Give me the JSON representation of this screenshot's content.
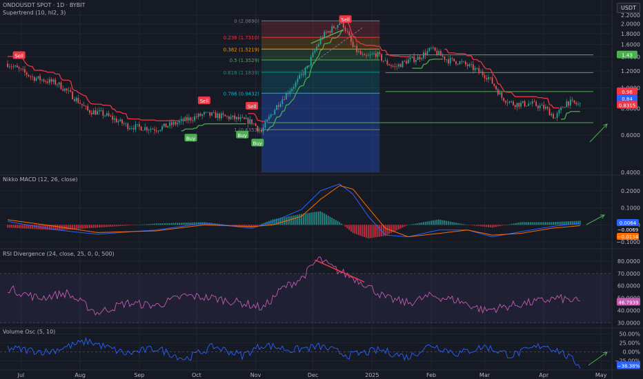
{
  "header": {
    "symbol_title": "ONDOUSDT SPOT · 1D · BYBIT",
    "supertrend_label": "Supertrend (10, hl2, 3)",
    "currency_button": "USDT"
  },
  "colors": {
    "background": "#161a25",
    "grid": "#222631",
    "bull": "#26a69a",
    "bear": "#ef5350",
    "supertrend_up": "#4caf50",
    "supertrend_down": "#f23645",
    "macd_line": "#2962ff",
    "signal_line": "#ff6d00",
    "rsi_line": "#c45bb0",
    "volume_osc_line": "#2962ff",
    "arrow_green": "#4caf50",
    "divergence_red": "#f23645"
  },
  "chart_data": [
    {
      "type": "candlestick",
      "name": "price",
      "y_axis": {
        "scale": "log",
        "ylim": [
          0.4,
          2.2
        ],
        "ticks": [
          "2.2000",
          "2.0000",
          "1.8000",
          "1.6000",
          "1.4000",
          "1.2000",
          "1.0000",
          "0.8000",
          "0.6000",
          "0.4000"
        ]
      },
      "x_ticks": [
        "Jul",
        "Aug",
        "Sep",
        "Oct",
        "Nov",
        "Dec",
        "2025",
        "Feb",
        "Mar",
        "Apr",
        "May"
      ],
      "path_dates": [
        "2024-06-24",
        "2024-07-07",
        "2024-07-20",
        "2024-08-05",
        "2024-08-12",
        "2024-08-26",
        "2024-09-10",
        "2024-09-20",
        "2024-10-05",
        "2024-10-12",
        "2024-10-20",
        "2024-10-30",
        "2024-11-04",
        "2024-11-12",
        "2024-11-22",
        "2024-11-28",
        "2024-12-06",
        "2024-12-11",
        "2024-12-16",
        "2024-12-22",
        "2024-12-28",
        "2025-01-03",
        "2025-01-08",
        "2025-01-13",
        "2025-01-20",
        "2025-01-25",
        "2025-02-01",
        "2025-02-06",
        "2025-02-10",
        "2025-02-15",
        "2025-02-22",
        "2025-03-03",
        "2025-03-10",
        "2025-03-16",
        "2025-03-26",
        "2025-04-02",
        "2025-04-07",
        "2025-04-13",
        "2025-04-20"
      ],
      "path_prices": [
        1.3,
        1.12,
        1.05,
        0.78,
        0.76,
        0.66,
        0.64,
        0.68,
        0.75,
        0.74,
        0.72,
        0.69,
        0.62,
        0.82,
        1.05,
        1.24,
        1.75,
        1.9,
        2.06,
        1.55,
        1.38,
        1.45,
        1.32,
        1.25,
        1.35,
        1.38,
        1.52,
        1.42,
        1.35,
        1.33,
        1.25,
        1.12,
        0.9,
        0.84,
        0.84,
        0.8,
        0.72,
        0.86,
        0.83
      ],
      "fibonacci": [
        {
          "label": "0 (2.0690)",
          "price": 2.069,
          "color": "#787b86"
        },
        {
          "label": "0.236 (1.7310)",
          "price": 1.731,
          "color": "#f23645"
        },
        {
          "label": "0.382 (1.5219)",
          "price": 1.5219,
          "color": "#ff9800"
        },
        {
          "label": "0.5 (1.3529)",
          "price": 1.3529,
          "color": "#4caf50"
        },
        {
          "label": "0.618 (1.1839)",
          "price": 1.1839,
          "color": "#089981"
        },
        {
          "label": "0.786 (0.9432)",
          "price": 0.9432,
          "color": "#00bcd4"
        },
        {
          "label": "1 (0.6353)",
          "price": 0.6353,
          "color": "#787b86"
        }
      ],
      "fib_dates": [
        "2024-11-04",
        "2025-01-05"
      ],
      "horizontal_levels": [
        {
          "price": 1.43,
          "start": "2025-01-08",
          "color": "#4caf50"
        },
        {
          "price": 1.18,
          "start": "2025-01-08",
          "color": "#4caf50"
        },
        {
          "price": 0.96,
          "start": "2025-01-08",
          "color": "#4caf50"
        },
        {
          "price": 0.685,
          "start": "2024-11-07",
          "color": "#4caf50"
        }
      ],
      "signals": [
        {
          "type": "Sell",
          "date": "2024-06-30",
          "price": 1.42
        },
        {
          "type": "Buy",
          "date": "2024-09-28",
          "price": 0.58
        },
        {
          "type": "Sell",
          "date": "2024-10-05",
          "price": 0.87
        },
        {
          "type": "Buy",
          "date": "2024-10-25",
          "price": 0.6
        },
        {
          "type": "Sell",
          "date": "2024-10-30",
          "price": 0.82
        },
        {
          "type": "Buy",
          "date": "2024-11-02",
          "price": 0.55
        },
        {
          "type": "Sell",
          "date": "2024-12-18",
          "price": 2.1
        }
      ],
      "price_labels": [
        {
          "text": "1.43",
          "price": 1.43,
          "color": "#4caf50"
        },
        {
          "text": "0.96",
          "price": 0.96,
          "color": "#f23645"
        },
        {
          "text": "0.84",
          "price": 0.89,
          "color": "#2962ff"
        },
        {
          "text": "0.8315",
          "price": 0.83,
          "color": "#f23645"
        }
      ]
    },
    {
      "type": "line",
      "name": "macd",
      "title": "Nikko MACD (12, 26, close)",
      "ylim": [
        -0.12,
        0.26
      ],
      "ticks": [
        "0.2000",
        "0.1000",
        "0.0000",
        "−0.1000"
      ],
      "path_dates": [
        "2024-06-24",
        "2024-07-20",
        "2024-08-10",
        "2024-09-10",
        "2024-10-05",
        "2024-10-30",
        "2024-11-10",
        "2024-11-25",
        "2024-12-05",
        "2024-12-15",
        "2024-12-22",
        "2024-12-30",
        "2025-01-08",
        "2025-01-20",
        "2025-02-05",
        "2025-02-20",
        "2025-03-05",
        "2025-03-20",
        "2025-04-05",
        "2025-04-20"
      ],
      "macd_path": [
        0.02,
        -0.03,
        -0.055,
        -0.03,
        0.01,
        -0.02,
        0.02,
        0.09,
        0.2,
        0.24,
        0.18,
        0.05,
        -0.06,
        -0.07,
        -0.03,
        -0.03,
        -0.07,
        -0.04,
        -0.01,
        0.01
      ],
      "signal_path": [
        0.03,
        -0.01,
        -0.045,
        -0.035,
        0.0,
        -0.01,
        0.0,
        0.05,
        0.15,
        0.23,
        0.21,
        0.1,
        -0.02,
        -0.07,
        -0.05,
        -0.03,
        -0.06,
        -0.05,
        -0.02,
        -0.005
      ],
      "labels": [
        {
          "text": "0.0064",
          "value": 0.0064,
          "color": "#2962ff"
        },
        {
          "text": "−0.0069",
          "value": -0.0069,
          "color": "#161a25"
        },
        {
          "text": "−0.0134",
          "value": -0.0134,
          "color": "#ff6d00"
        }
      ]
    },
    {
      "type": "line",
      "name": "rsi",
      "title": "RSI Divergence (24, close, 25, 0, 0, 500)",
      "ylim": [
        28,
        85
      ],
      "ticks": [
        "80.0000",
        "70.0000",
        "60.0000",
        "50.0000",
        "40.0000",
        "30.0000"
      ],
      "path_dates": [
        "2024-06-24",
        "2024-07-10",
        "2024-07-25",
        "2024-08-10",
        "2024-08-25",
        "2024-09-10",
        "2024-09-25",
        "2024-10-10",
        "2024-10-25",
        "2024-11-05",
        "2024-11-15",
        "2024-11-25",
        "2024-12-04",
        "2024-12-12",
        "2024-12-20",
        "2024-12-28",
        "2025-01-08",
        "2025-01-20",
        "2025-02-01",
        "2025-02-15",
        "2025-03-01",
        "2025-03-15",
        "2025-04-01",
        "2025-04-08",
        "2025-04-20"
      ],
      "rsi_path": [
        58,
        50,
        54,
        38,
        46,
        44,
        52,
        50,
        46,
        42,
        58,
        66,
        82,
        74,
        68,
        62,
        50,
        46,
        52,
        48,
        40,
        44,
        48,
        50,
        47
      ],
      "divergence": {
        "from": [
          "2024-12-02",
          81
        ],
        "to": [
          "2024-12-28",
          63
        ]
      },
      "labels": [
        {
          "text": "46.7939",
          "value": 46.79,
          "color": "#c45bb0"
        }
      ]
    },
    {
      "type": "line",
      "name": "volume_osc",
      "title": "Volume Osc (5, 10)",
      "ylim": [
        -45,
        55
      ],
      "ticks": [
        "50.00%",
        "25.00%",
        "0.00%",
        "−25.00%"
      ],
      "path_dates": [
        "2024-06-24",
        "2024-07-15",
        "2024-08-05",
        "2024-08-25",
        "2024-09-10",
        "2024-09-25",
        "2024-10-10",
        "2024-10-25",
        "2024-11-05",
        "2024-11-20",
        "2024-12-05",
        "2024-12-20",
        "2025-01-05",
        "2025-01-20",
        "2025-02-01",
        "2025-02-15",
        "2025-03-01",
        "2025-03-15",
        "2025-04-01",
        "2025-04-10",
        "2025-04-20"
      ],
      "vol_path": [
        10,
        0,
        30,
        -5,
        10,
        -20,
        15,
        -10,
        20,
        5,
        15,
        -10,
        5,
        -15,
        20,
        -5,
        15,
        -10,
        20,
        0,
        -38
      ],
      "labels": [
        {
          "text": "−38.38%",
          "value": -38.38,
          "color": "#2962ff"
        }
      ]
    }
  ]
}
